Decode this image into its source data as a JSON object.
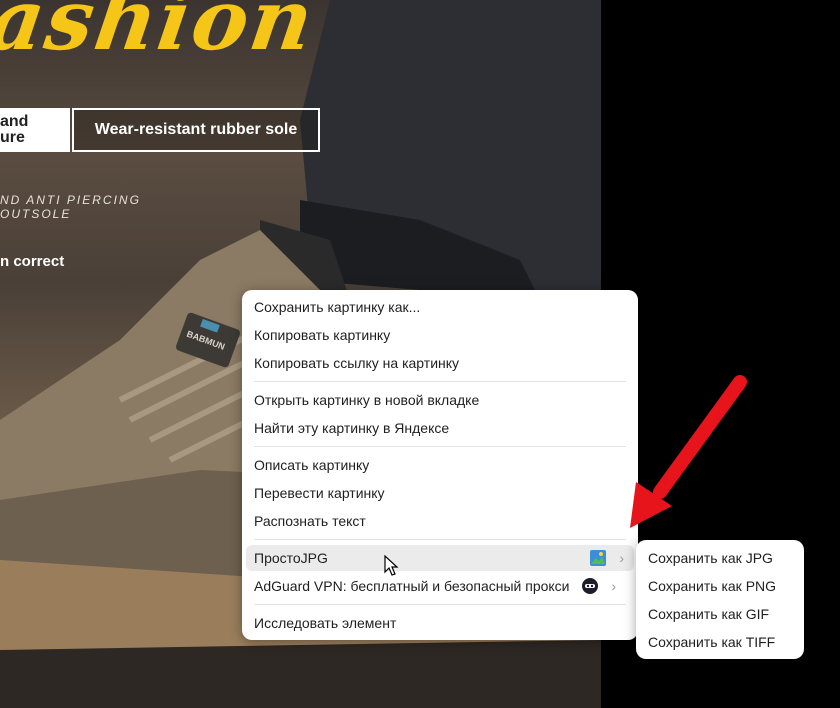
{
  "photo": {
    "headline": "ashion",
    "badge_left_lines": [
      "and",
      "ure"
    ],
    "badge_right": "Wear-resistant rubber sole",
    "small_lines": [
      "ND ANTI PIERCING",
      "OUTSOLE"
    ],
    "correct_text": "n correct",
    "tongue_label": "BABMUN"
  },
  "context_menu": {
    "items": [
      "Сохранить картинку как...",
      "Копировать картинку",
      "Копировать ссылку на картинку",
      "Открыть картинку в новой вкладке",
      "Найти эту картинку в Яндексе",
      "Описать картинку",
      "Перевести картинку",
      "Распознать текст",
      "ПростоJPG",
      "AdGuard VPN: бесплатный и безопасный прокси",
      "Исследовать элемент"
    ],
    "chevron": "›"
  },
  "submenu": {
    "items": [
      "Сохранить как JPG",
      "Сохранить как PNG",
      "Сохранить как GIF",
      "Сохранить как TIFF"
    ]
  },
  "colors": {
    "headline": "#f5c518",
    "arrow": "#e8141b",
    "hover": "#ebebeb"
  }
}
